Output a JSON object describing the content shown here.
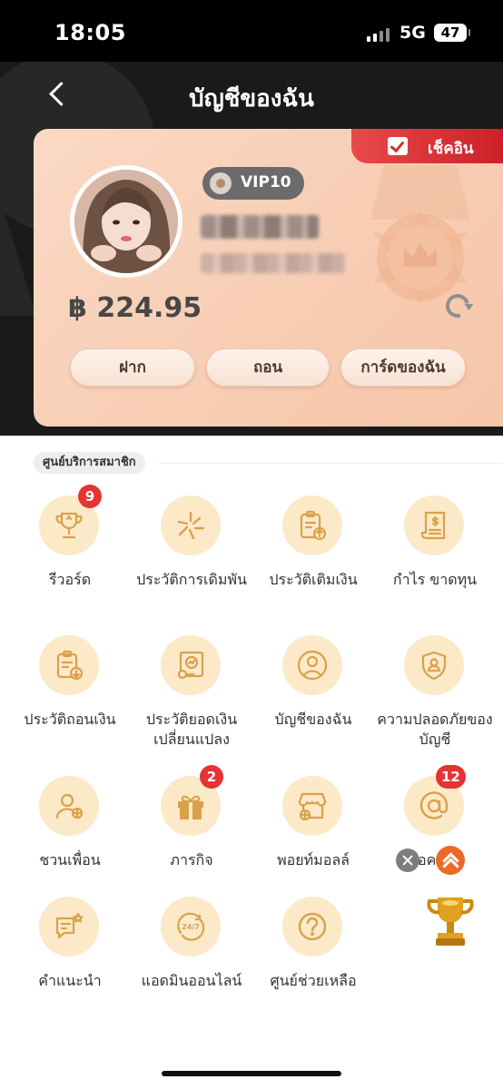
{
  "status_bar": {
    "time": "18:05",
    "network": "5G",
    "battery": "47"
  },
  "header": {
    "title": "บัญชีของฉัน"
  },
  "account": {
    "checkin_label": "เช็คอิน",
    "vip_label": "VIP10",
    "balance": "฿ 224.95",
    "buttons": [
      "ฝาก",
      "ถอน",
      "การ์ดของฉัน"
    ]
  },
  "section": {
    "title": "ศูนย์บริการสมาชิก",
    "items": [
      {
        "label": "รีวอร์ด",
        "icon": "trophy-icon",
        "badge": "9"
      },
      {
        "label": "ประวัติการเดิมพัน",
        "icon": "spark-icon",
        "badge": ""
      },
      {
        "label": "ประวัติเติมเงิน",
        "icon": "clipboard-upload-icon",
        "badge": ""
      },
      {
        "label": "กำไร ขาดทุน",
        "icon": "receipt-dollar-icon",
        "badge": ""
      },
      {
        "label": "ประวัติถอนเงิน",
        "icon": "clipboard-download-icon",
        "badge": ""
      },
      {
        "label": "ประวัติยอดเงินเปลี่ยนแปลง",
        "icon": "chart-report-icon",
        "badge": ""
      },
      {
        "label": "บัญชีของฉัน",
        "icon": "user-circle-icon",
        "badge": ""
      },
      {
        "label": "ความปลอดภัยของบัญชี",
        "icon": "shield-user-icon",
        "badge": ""
      },
      {
        "label": "ชวนเพื่อน",
        "icon": "user-add-icon",
        "badge": ""
      },
      {
        "label": "ภารกิจ",
        "icon": "gift-icon",
        "badge": "2"
      },
      {
        "label": "พอยท์มอลล์",
        "icon": "store-icon",
        "badge": ""
      },
      {
        "label": "ข้อความ",
        "icon": "at-icon",
        "badge": "12"
      },
      {
        "label": "คำแนะนำ",
        "icon": "chat-star-icon",
        "badge": ""
      },
      {
        "label": "แอดมินออนไลน์",
        "icon": "support-24-7-icon",
        "badge": ""
      },
      {
        "label": "ศูนย์ช่วยเหลือ",
        "icon": "question-icon",
        "badge": ""
      }
    ]
  },
  "colors": {
    "accent": "#d9a24a",
    "icon_bg": "#fbe9c8",
    "badge": "#e63333",
    "card": "#f8d0b8",
    "header": "#1a1a1a"
  }
}
